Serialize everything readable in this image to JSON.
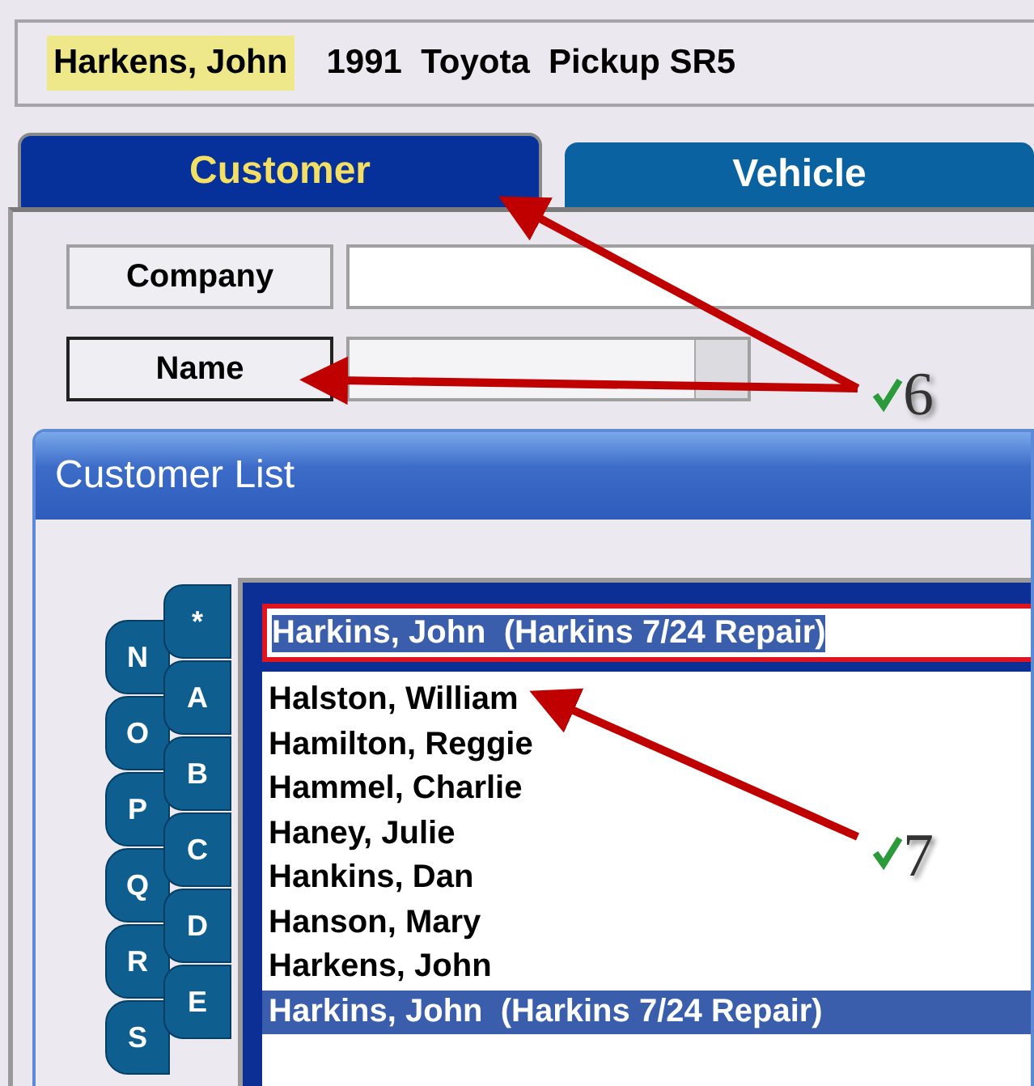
{
  "header": {
    "customer": "Harkens, John",
    "vehicle": "1991  Toyota  Pickup SR5"
  },
  "tabs": [
    {
      "label": "Customer",
      "selected": true
    },
    {
      "label": "Vehicle",
      "selected": false
    }
  ],
  "form": {
    "company_button": "Company",
    "name_button": "Name"
  },
  "callouts": [
    {
      "label": "6"
    },
    {
      "label": "7"
    }
  ],
  "dialog": {
    "title": "Customer List",
    "letter_tabs_left": [
      "N",
      "O",
      "P",
      "Q",
      "R",
      "S"
    ],
    "letter_tabs_right": [
      "*",
      "A",
      "B",
      "C",
      "D",
      "E"
    ],
    "search": {
      "value": "Harkins, John  (Harkins 7/24 Repair)"
    },
    "items": [
      {
        "label": "Halston, William",
        "selected": false
      },
      {
        "label": "Hamilton, Reggie",
        "selected": false
      },
      {
        "label": "Hammel, Charlie",
        "selected": false
      },
      {
        "label": "Haney, Julie",
        "selected": false
      },
      {
        "label": "Hankins, Dan",
        "selected": false
      },
      {
        "label": "Hanson, Mary",
        "selected": false
      },
      {
        "label": "Harkens, John",
        "selected": false
      },
      {
        "label": "Harkins, John  (Harkins 7/24 Repair)",
        "selected": true
      }
    ]
  }
}
